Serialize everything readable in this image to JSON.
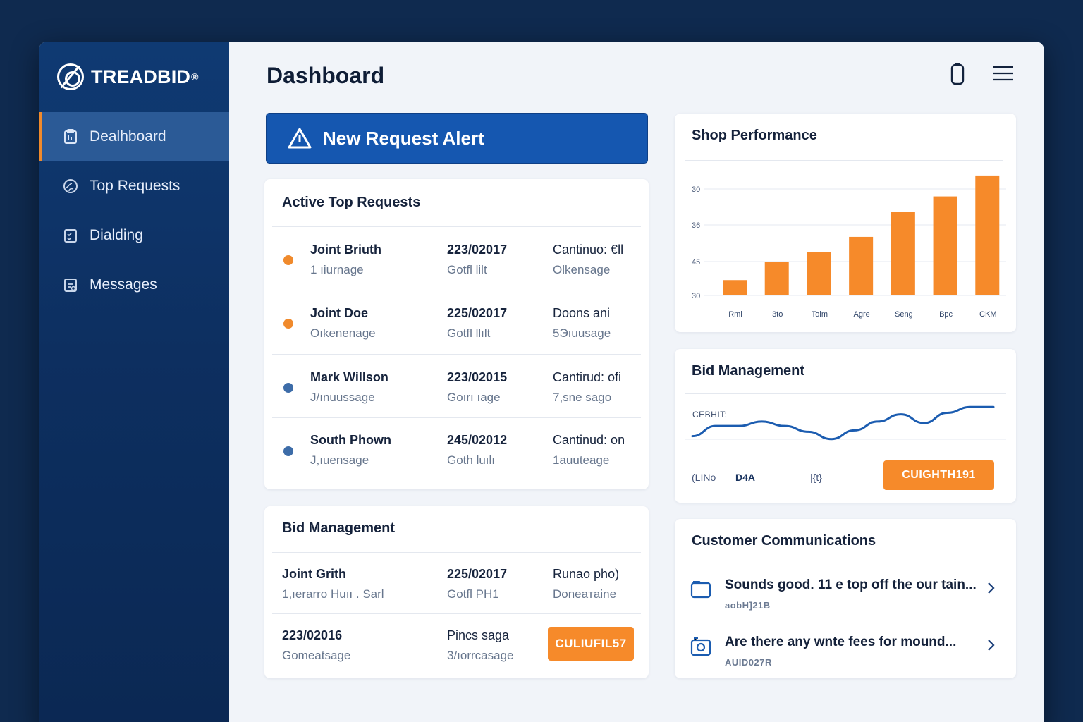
{
  "brand": {
    "name": "TREADBID",
    "mark": "®"
  },
  "sidebar": {
    "items": [
      {
        "label": "Dealhboard",
        "icon": "clipboard-icon",
        "active": true
      },
      {
        "label": "Top Requests",
        "icon": "globe-icon"
      },
      {
        "label": "Dialding",
        "icon": "checklist-icon"
      },
      {
        "label": "Messages",
        "icon": "message-doc-icon"
      }
    ]
  },
  "header": {
    "title": "Dashboard"
  },
  "alert": {
    "label": "New Request Alert"
  },
  "requests": {
    "title": "Active Top Requests",
    "rows": [
      {
        "name": "Joint Briuth",
        "name_sub": "1 ıiurnage",
        "date": "223/02017",
        "date_sub": "Gotfl lilt",
        "status": "Cantinuo: €ll",
        "status_sub": "Olkensage",
        "dot": "#f08a2c"
      },
      {
        "name": "Joint Doe",
        "name_sub": "Oıkenenage",
        "date": "225/02017",
        "date_sub": "Gotfl llılt",
        "status": "Doons ani",
        "status_sub": "5Эıuusage",
        "dot": "#f08a2c"
      },
      {
        "name": "Mark Willson",
        "name_sub": "J/ınuussage",
        "date": "223/02015",
        "date_sub": "Goırı ıage",
        "status": "Cantirud: ofi",
        "status_sub": "7,sne sago",
        "dot": "#3d6ca8"
      },
      {
        "name": "South Phown",
        "name_sub": "J,ıuensage",
        "date": "245/02012",
        "date_sub": "Goth luılı",
        "status": "Cantinud: on",
        "status_sub": "1auuteage",
        "dot": "#3d6ca8"
      }
    ]
  },
  "bids": {
    "title": "Bid Management",
    "row1": {
      "name": "Joint Grith",
      "name_sub": "1,ıerarro Huıı . Sarl",
      "date": "225/02017",
      "date_sub": "Gotfl PH1",
      "status": "Runao pho)",
      "status_sub": "Doneaтaine"
    },
    "row2": {
      "date": "223/02016",
      "date_sub": "Gomeatsage",
      "status": "Pincs saga",
      "status_sub": "3/ıorrcasage",
      "button": "CULIUFIL57"
    }
  },
  "performance": {
    "title": "Shop Performance"
  },
  "chart_data": {
    "type": "bar",
    "title": "Shop Performance",
    "categories": [
      "Rmi",
      "3to",
      "Toim",
      "Agre",
      "Seng",
      "Bpc",
      "CKM"
    ],
    "y_tick_labels": [
      "30",
      "36",
      "45",
      "30"
    ],
    "values": [
      11,
      24,
      31,
      42,
      60,
      71,
      86
    ],
    "ylim": [
      0,
      90
    ],
    "grid": true,
    "color": "#f68a2a"
  },
  "bidmgmt": {
    "title": "Bid Management",
    "label": "CEBHIT:",
    "line_values": [
      21,
      28,
      28,
      31,
      28,
      24,
      19,
      25,
      31,
      36,
      30,
      37,
      41,
      41
    ],
    "foot_left": "(LINo",
    "foot_mid": "D4A",
    "foot_right": "|{t}",
    "button": "CUIGHTH191",
    "line_color": "#1b5cb0"
  },
  "comms": {
    "title": "Customer Communications",
    "messages": [
      {
        "text": "Sounds good. 11 e top off the our tain...",
        "sub": "aobH]21B",
        "icon": "folder-icon"
      },
      {
        "text": "Are there any wnte fees for mound...",
        "sub": "AUID027R",
        "icon": "camera-icon"
      }
    ]
  },
  "colors": {
    "accent": "#f68a2a",
    "primary": "#1557b0",
    "sidebar": "#0f3a73"
  }
}
